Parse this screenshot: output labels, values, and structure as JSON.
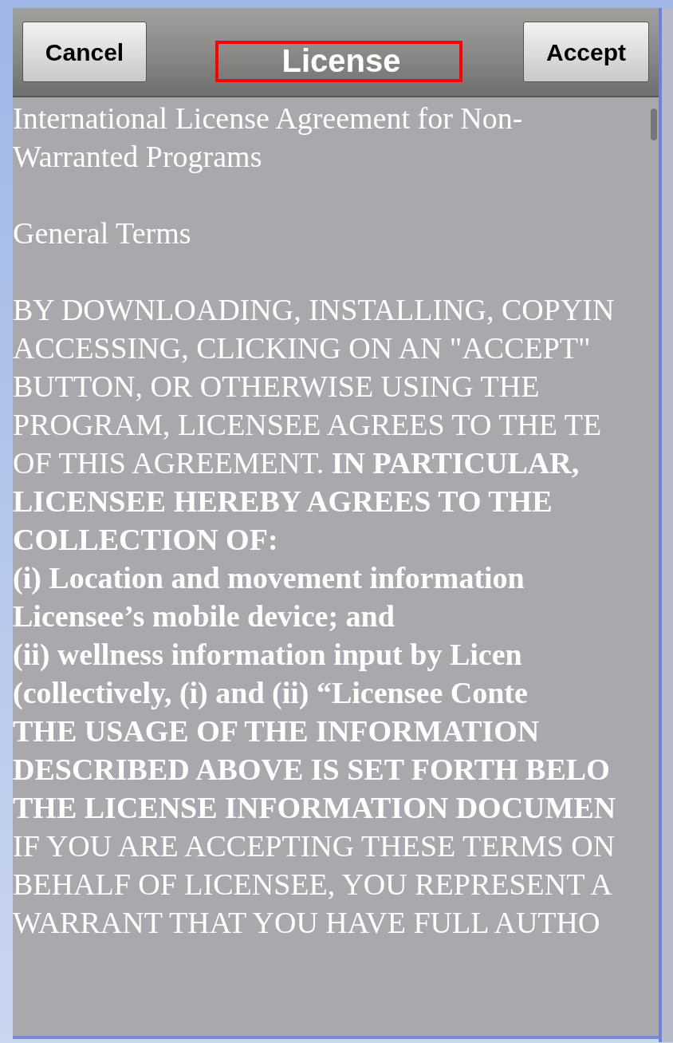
{
  "header": {
    "cancel_button": "Cancel",
    "title": "License",
    "title_highlighted": true,
    "accept_button": "Accept"
  },
  "license_text": [
    {
      "lines": [
        {
          "text": "International License Agreement for Non-",
          "bold": false
        },
        {
          "text": "Warranted Programs",
          "bold": false
        }
      ]
    },
    {
      "lines": [
        {
          "text": "General Terms",
          "bold": false
        }
      ]
    },
    {
      "lines": [
        {
          "text": "BY DOWNLOADING, INSTALLING, COPYIN",
          "bold": false
        },
        {
          "text": "ACCESSING, CLICKING ON AN \"ACCEPT\"",
          "bold": false
        },
        {
          "text": "BUTTON, OR OTHERWISE USING THE",
          "bold": false
        },
        {
          "text": "PROGRAM, LICENSEE AGREES TO THE TE",
          "bold": false
        },
        {
          "text": "OF THIS AGREEMENT. **IN PARTICULAR,**",
          "bold": false
        },
        {
          "text": "LICENSEE HEREBY AGREES TO THE",
          "bold": true
        },
        {
          "text": "COLLECTION OF:",
          "bold": true
        },
        {
          "text": "(i) Location and movement information",
          "bold": true
        },
        {
          "text": "Licensee’s mobile device; and",
          "bold": true
        },
        {
          "text": "(ii) wellness information input by Licen",
          "bold": true
        },
        {
          "text": "(collectively, (i) and (ii) “Licensee Conte",
          "bold": true
        },
        {
          "text": "THE USAGE OF THE INFORMATION",
          "bold": true
        },
        {
          "text": "DESCRIBED ABOVE IS SET FORTH BELO",
          "bold": true
        },
        {
          "text": "THE LICENSE INFORMATION DOCUMEN",
          "bold": true
        },
        {
          "text": "IF YOU ARE ACCEPTING THESE TERMS ON",
          "bold": false
        },
        {
          "text": "BEHALF OF LICENSEE, YOU REPRESENT A",
          "bold": false
        },
        {
          "text": "WARRANT THAT YOU HAVE FULL AUTHO",
          "bold": false
        }
      ]
    }
  ]
}
